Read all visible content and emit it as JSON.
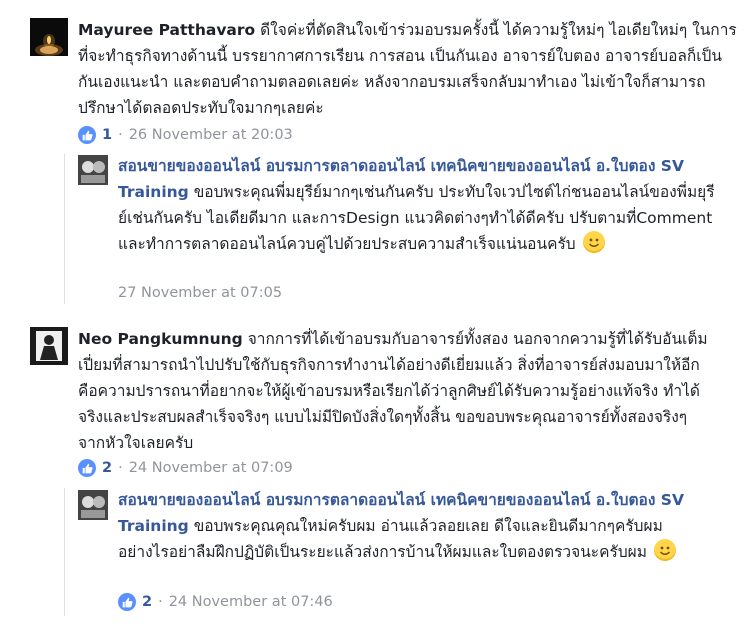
{
  "comments": [
    {
      "author": "Mayuree Patthavaro",
      "text": " ดีใจค่ะที่ตัดสินใจเข้าร่วมอบรมครั้งนี้ ได้ความรู้ใหม่ๆ ไอเดียใหม่ๆ ในการที่จะทำธุรกิจทางด้านนี้ บรรยากาศการเรียน การสอน เป็นกันเอง อาจารย์ใบตอง อาจารย์บอลก็เป็นกันเองแนะนำ และตอบคำถามตลอดเลยค่ะ หลังจากอบรมเสร็จกลับมาทำเอง ไม่เข้าใจก็สามารถปรึกษาได้ตลอดประทับใจมากๆเลยค่ะ",
      "likes": "1",
      "time": "26 November at 20:03",
      "reply": {
        "author": "สอนขายของออนไลน์ อบรมการตลาดออนไลน์ เทคนิคขายของออนไลน์ อ.ใบตอง SV Training",
        "text": " ขอบพระคุณพี่มยุรีย์มากๆเช่นกันครับ ประทับใจเวปไซต์ไก่ชนออนไลน์ของพี่มยุรีย์เช่นกันครับ ไอเดียดีมาก และการDesign แนวคิดต่างๆทำได้ดีครับ ปรับตามที่Comment และทำการตลาดออนไลน์ควบคู่ไปด้วยประสบความสำเร็จแน่นอนครับ",
        "time": "27 November at 07:05"
      }
    },
    {
      "author": "Neo Pangkumnung",
      "text": " จากการที่ได้เข้าอบรมกับอาจารย์ทั้งสอง นอกจากความรู้ที่ได้รับอันเต็มเปี่ยมที่สามารถนำไปปรับใช้กับธุรกิจการทำงานได้อย่างดีเยี่ยมแล้ว สิ่งที่อาจารย์ส่งมอบมาให้อีกคือความปรารถนาที่อยากจะให้ผู้เข้าอบรมหรือเรียกได้ว่าลูกศิษย์ได้รับความรู้อย่างแท้จริง ทำได้จริงและประสบผลสำเร็จจริงๆ แบบไม่มีปิดบังสิ่งใดๆทั้งสิ้น ขอขอบพระคุณอาจารย์ทั้งสองจริงๆจากหัวใจเลยครับ",
      "likes": "2",
      "time": "24 November at 07:09",
      "reply": {
        "author": "สอนขายของออนไลน์ อบรมการตลาดออนไลน์ เทคนิคขายของออนไลน์ อ.ใบตอง SV Training",
        "text": " ขอบพระคุณคุณใหม่ครับผม อ่านแล้วลอยเลย ดีใจและยินดีมากๆครับผม อย่างไรอย่าลืมฝึกปฏิบัติเป็นระยะแล้วส่งการบ้านให้ผมและใบตองตรวจนะครับผม",
        "likes": "2",
        "time": "24 November at 07:46"
      }
    }
  ],
  "icons": {
    "like": "thumbs-up-icon",
    "emoji": "smiley-emoji-icon"
  },
  "colors": {
    "link": "#365899",
    "meta": "#90949c",
    "like_badge": "#5890ff"
  }
}
